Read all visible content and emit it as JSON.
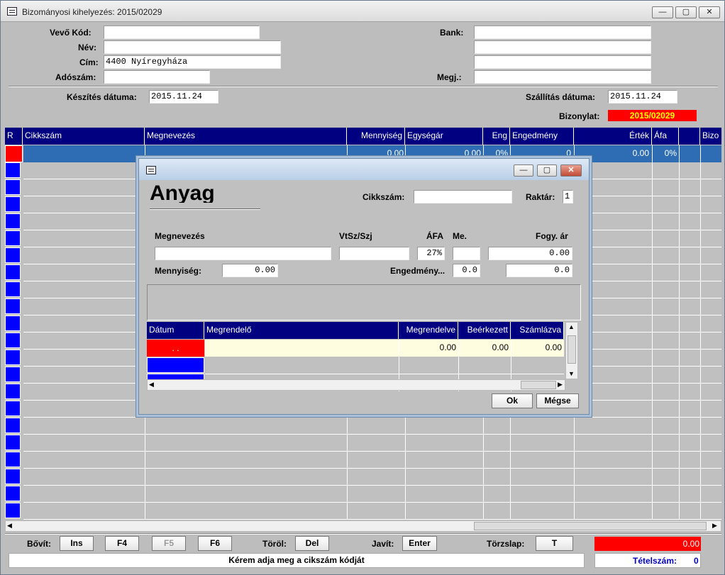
{
  "window": {
    "title": "Bizományosi kihelyezés: 2015/02029",
    "min": "—",
    "max": "▢",
    "close": "✕"
  },
  "form": {
    "vevo_kod_label": "Vevő  Kód:",
    "vevo_kod_value": "",
    "nev_label": "Név:",
    "nev_value": "",
    "cim_label": "Cím:",
    "cim_value": "4400 Nyíregyháza",
    "adoszam_label": "Adószám:",
    "adoszam_value": "",
    "bank_label": "Bank:",
    "bank_value": "",
    "bank2_value": "",
    "bank3_value": "",
    "megj_label": "Megj.:",
    "megj_value": "",
    "keszites_label": "Készítés dátuma:",
    "keszites_value": "2015.11.24",
    "szallitas_label": "Szállítás dátuma:",
    "szallitas_value": "2015.11.24",
    "bizonylat_label": "Bizonylat:",
    "bizonylat_value": "2015/02029"
  },
  "grid": {
    "headers": [
      "R",
      "Cikkszám",
      "Megnevezés",
      "Mennyiség",
      "Egységár",
      "Eng",
      "Engedmény",
      "Érték",
      "Áfa",
      "",
      "Bizo"
    ],
    "row1": [
      "",
      "",
      "",
      "0.00",
      "0.00",
      "0%",
      "0",
      "0.00",
      "0%",
      "",
      ""
    ]
  },
  "footer": {
    "bovit_label": "Bővít:",
    "ins": "Ins",
    "f4": "F4",
    "f5": "F5",
    "f6": "F6",
    "torol_label": "Töröl:",
    "del": "Del",
    "javit_label": "Javít:",
    "enter": "Enter",
    "torzslap_label": "Törzslap:",
    "t": "T",
    "total": "0.00",
    "status": "Kérem adja meg a cikszám kódját",
    "tetelszam_label": "Tételszám:",
    "tetelszam_value": "0"
  },
  "dialog": {
    "heading": "Anyag",
    "cikkszam_label": "Cikkszám:",
    "cikkszam_value": "",
    "raktar_label": "Raktár:",
    "raktar_value": "1",
    "megnevezes_label": "Megnevezés",
    "megnevezes_value": "",
    "vtsz_label": "VtSz/Szj",
    "vtsz_value": "",
    "afa_label": "ÁFA",
    "afa_value": "27%",
    "me_label": "Me.",
    "me_value": "",
    "fogy_label": "Fogy. ár",
    "fogy_value": "0.00",
    "mennyiseg_label": "Mennyiség:",
    "mennyiseg_value": "0.00",
    "engedmeny_label": "Engedmény...",
    "engedmeny_value": "0.0",
    "engedmeny2_value": "0.0",
    "sub_headers": [
      "Dátum",
      "Megrendelő",
      "Megrendelve",
      "Beérkezett",
      "Számlázva"
    ],
    "sub_row": {
      "datum": ". .",
      "megrendelo": "",
      "megrendelve": "0.00",
      "beerkezett": "0.00",
      "szamlazva": "0.00"
    },
    "ok": "Ok",
    "megse": "Mégse"
  },
  "colors": {
    "header_blue": "#000080",
    "marker_blue": "#0000ff",
    "alert_red": "#ff0000",
    "selected_row": "#2e6db4"
  }
}
